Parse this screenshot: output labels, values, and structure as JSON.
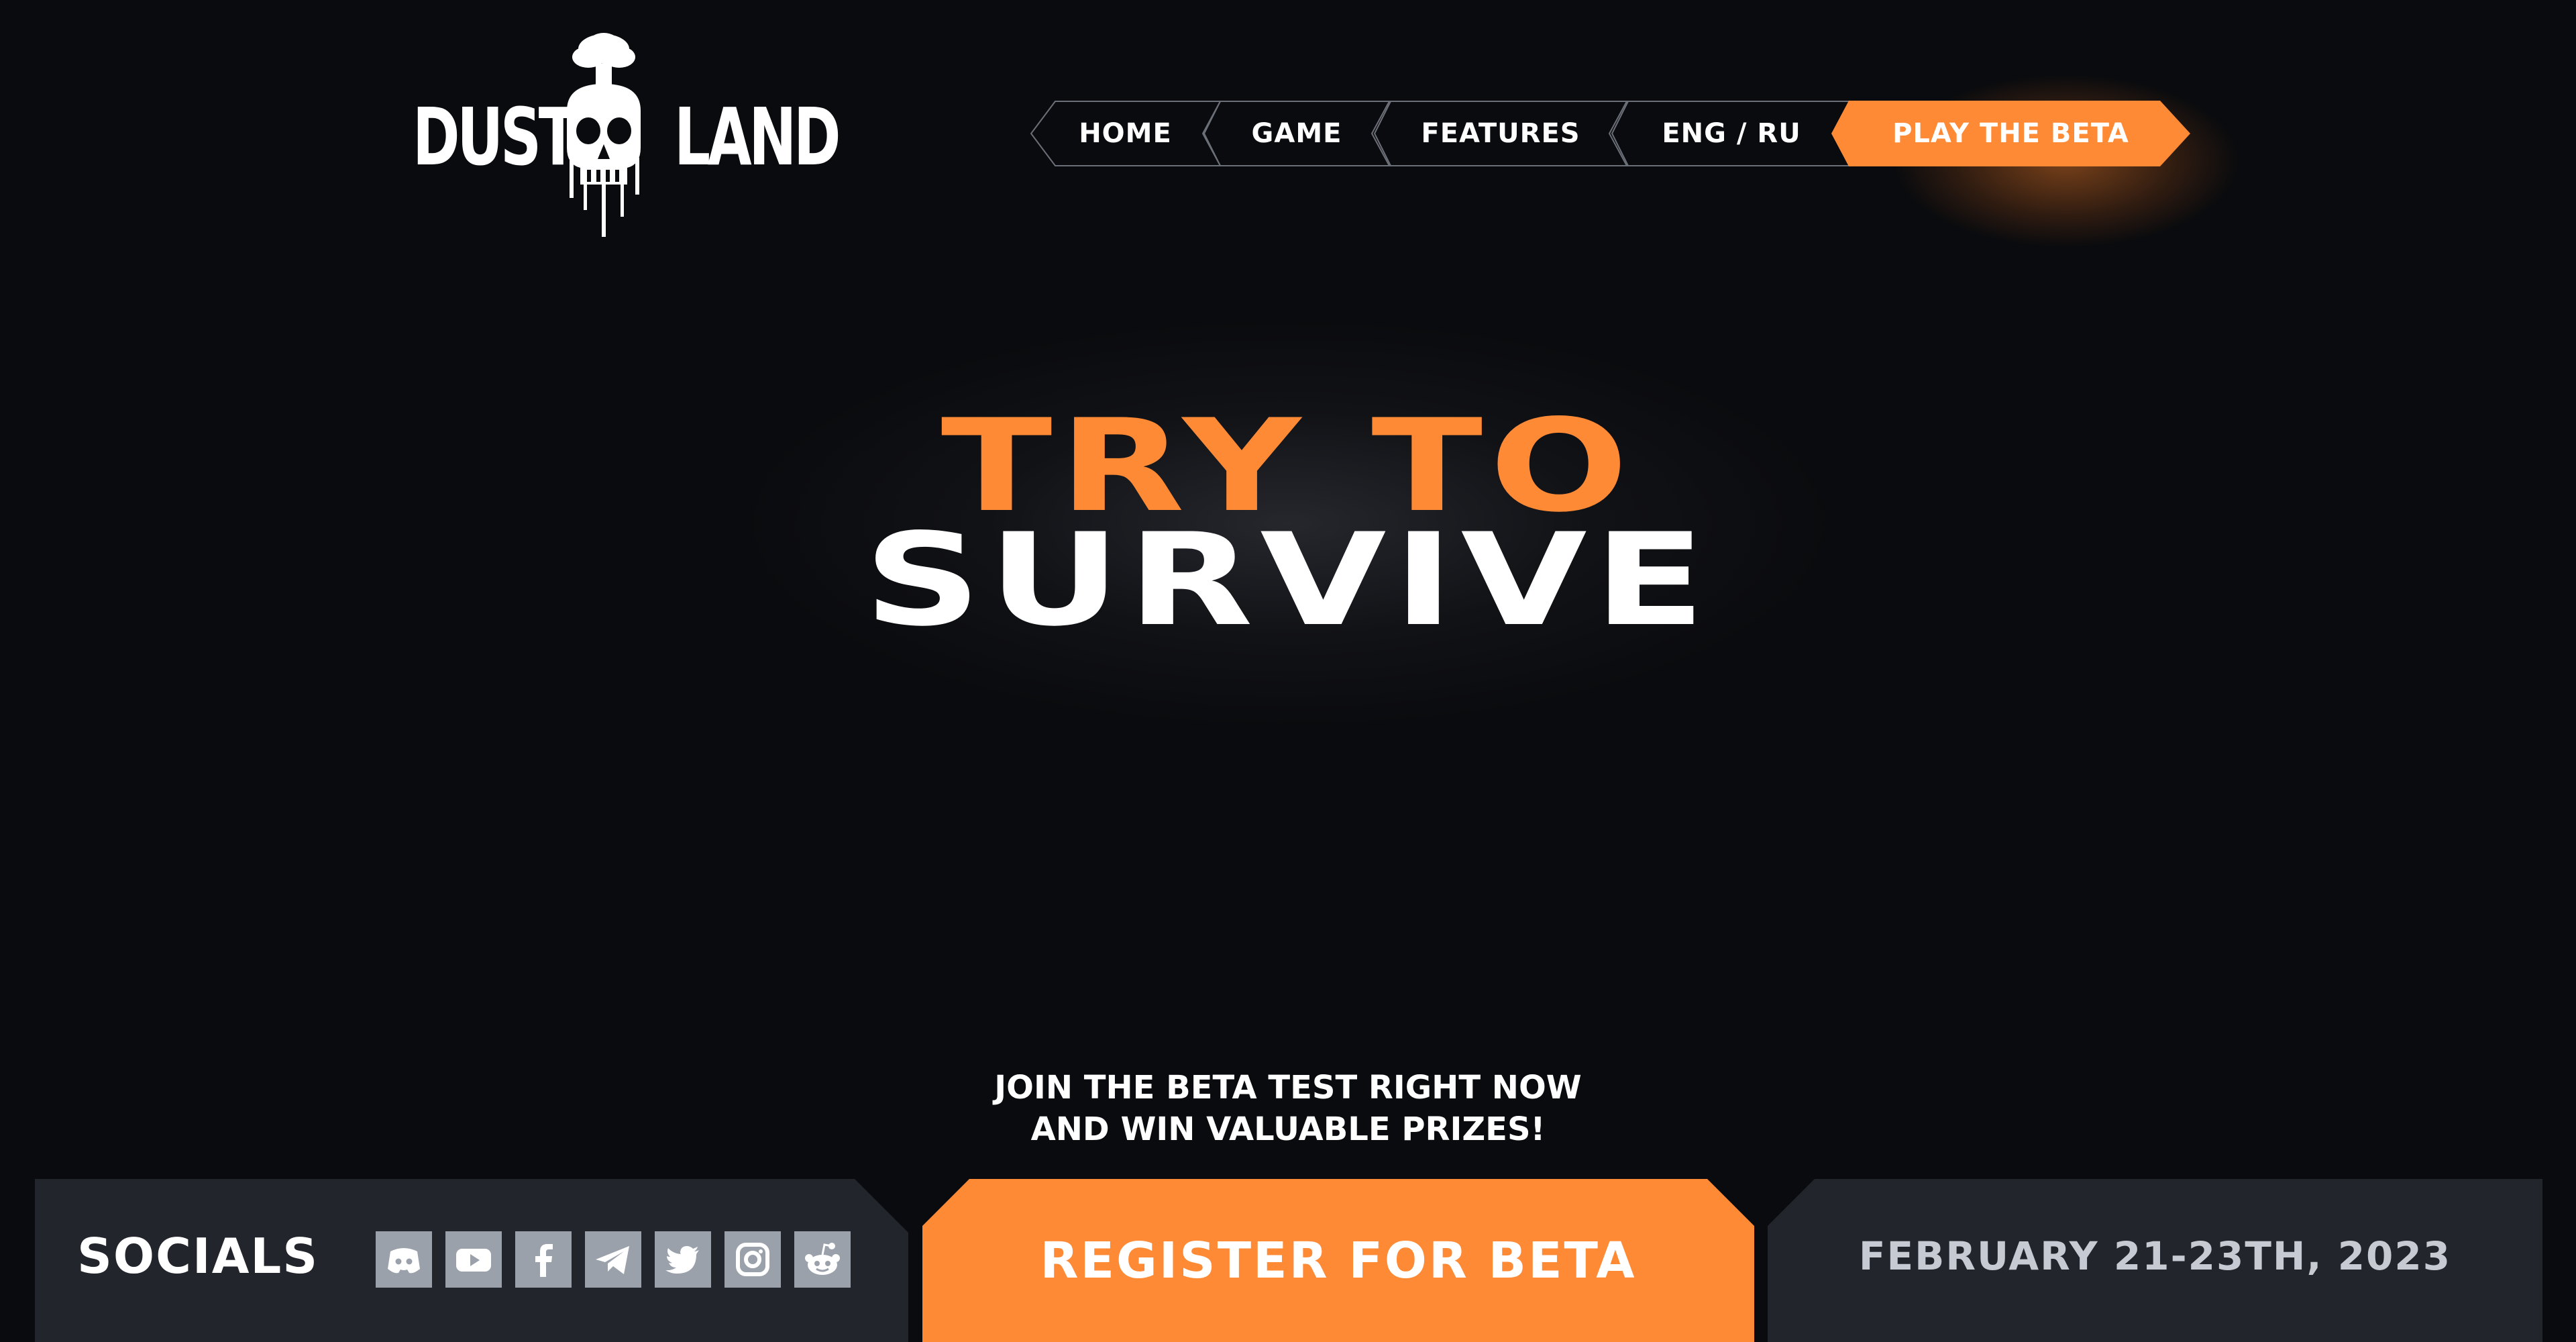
{
  "brand": {
    "logo_left": "DUST",
    "logo_right": "LAND",
    "logo_icon": "mushroom-cloud-skull-icon"
  },
  "nav": {
    "items": [
      {
        "label": "HOME"
      },
      {
        "label": "GAME"
      },
      {
        "label": "FEATURES"
      },
      {
        "label": "ENG / RU"
      }
    ],
    "cta_label": "PLAY THE BETA"
  },
  "hero": {
    "line1": "TRY TO",
    "line2": "SURVIVE",
    "tagline_line1": "JOIN THE BETA TEST RIGHT NOW",
    "tagline_line2": "AND WIN VALUABLE PRIZES!"
  },
  "footer": {
    "socials_label": "SOCIALS",
    "socials": [
      {
        "icon": "discord-icon"
      },
      {
        "icon": "youtube-icon"
      },
      {
        "icon": "facebook-icon"
      },
      {
        "icon": "telegram-icon"
      },
      {
        "icon": "twitter-icon"
      },
      {
        "icon": "instagram-icon"
      },
      {
        "icon": "reddit-icon"
      }
    ],
    "register_label": "REGISTER FOR BETA",
    "date_label": "FEBRUARY 21-23TH, 2023"
  },
  "colors": {
    "accent": "#ff8a35",
    "background": "#0a0b0e",
    "panel": "#22252b",
    "social_tile": "#9aa1ab",
    "date_text": "#c6cad2"
  }
}
